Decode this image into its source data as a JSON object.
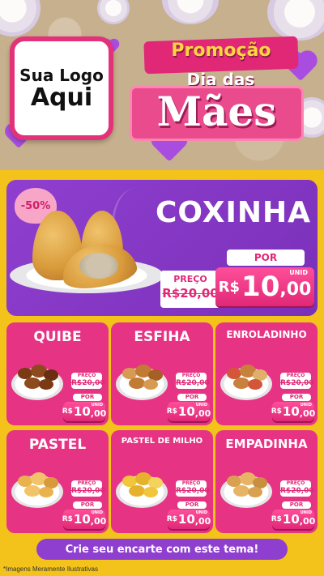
{
  "header": {
    "logo_line1": "Sua Logo",
    "logo_line2": "Aqui",
    "promo_title": "Promoção",
    "promo_sub": "Dia das",
    "promo_main": "Mães"
  },
  "featured": {
    "discount": "-50%",
    "name": "COXINHA",
    "preco_label": "PREÇO",
    "old_price": "R$20,00",
    "por_label": "POR",
    "new_price_currency": "R$",
    "new_price_int": "10",
    "new_price_cents": ",00",
    "unit_label": "UNID"
  },
  "products": [
    {
      "name": "QUIBE",
      "preco_label": "PREÇO",
      "old_price": "R$20,00",
      "por_label": "POR",
      "currency": "R$",
      "price_int": "10",
      "price_cents": ",00",
      "unit_label": "UNID"
    },
    {
      "name": "ESFIHA",
      "preco_label": "PREÇO",
      "old_price": "R$20,00",
      "por_label": "POR",
      "currency": "R$",
      "price_int": "10",
      "price_cents": ",00",
      "unit_label": "UNID"
    },
    {
      "name": "ENROLADINHO",
      "preco_label": "PREÇO",
      "old_price": "R$20,00",
      "por_label": "POR",
      "currency": "R$",
      "price_int": "10",
      "price_cents": ",00",
      "unit_label": "UNID"
    },
    {
      "name": "PASTEL",
      "preco_label": "PREÇO",
      "old_price": "R$20,00",
      "por_label": "POR",
      "currency": "R$",
      "price_int": "10",
      "price_cents": ",00",
      "unit_label": "UNID"
    },
    {
      "name": "PASTEL DE MILHO",
      "preco_label": "PREÇO",
      "old_price": "R$20,00",
      "por_label": "POR",
      "currency": "R$",
      "price_int": "10",
      "price_cents": ",00",
      "unit_label": "UNID"
    },
    {
      "name": "EMPADINHA",
      "preco_label": "PREÇO",
      "old_price": "R$20,00",
      "por_label": "POR",
      "currency": "R$",
      "price_int": "10",
      "price_cents": ",00",
      "unit_label": "UNID"
    }
  ],
  "footer": {
    "cta": "Crie seu encarte com este tema!",
    "disclaimer": "*Imagens Meramente Ilustrativas"
  },
  "colors": {
    "background": "#f3c21b",
    "card_pink": "#e73383",
    "featured_purple": "#8f3fcf",
    "accent_pink": "#e02877"
  }
}
